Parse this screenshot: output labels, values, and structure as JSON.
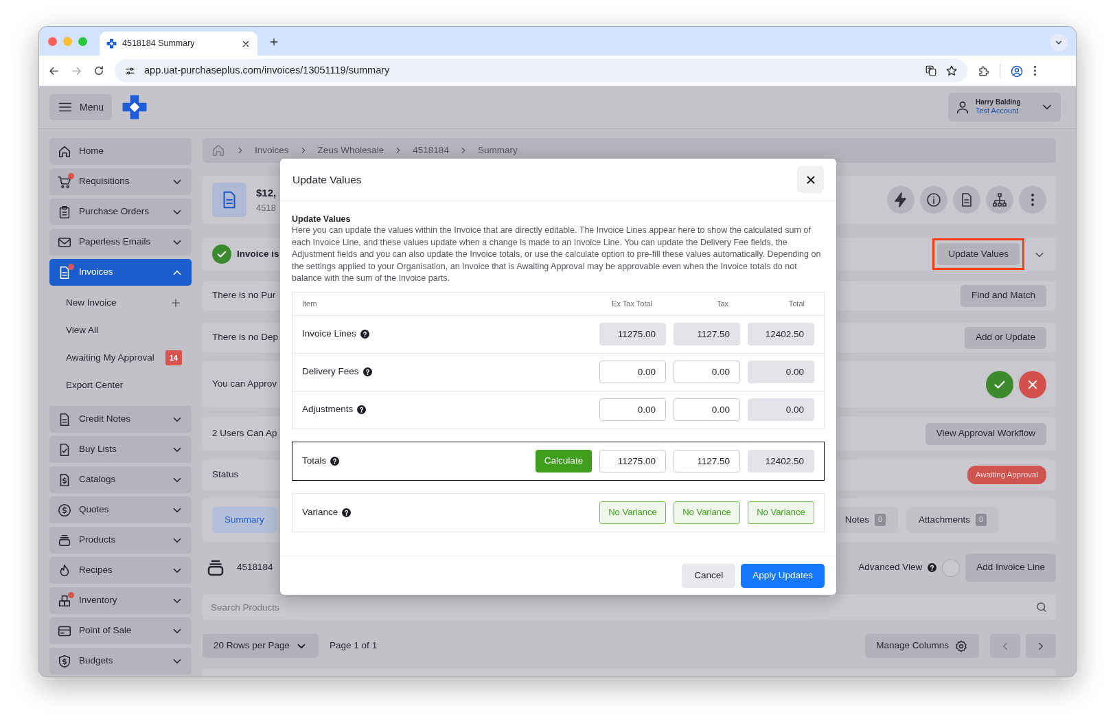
{
  "browser": {
    "tab_title": "4518184 Summary",
    "url": "app.uat-purchaseplus.com/invoices/13051119/summary"
  },
  "header": {
    "menu_label": "Menu",
    "user_name": "Harry Balding",
    "account": "Test Account"
  },
  "sidebar": {
    "items": [
      {
        "label": "Home",
        "kind": "link",
        "selected": false,
        "notification": false
      },
      {
        "label": "Requisitions",
        "kind": "group",
        "expanded": false,
        "selected": false,
        "notification": true
      },
      {
        "label": "Purchase Orders",
        "kind": "group",
        "expanded": false,
        "selected": false,
        "notification": false
      },
      {
        "label": "Paperless Emails",
        "kind": "group",
        "expanded": false,
        "selected": false,
        "notification": false
      },
      {
        "label": "Invoices",
        "kind": "group",
        "expanded": true,
        "selected": true,
        "notification": true,
        "children": [
          {
            "label": "New Invoice",
            "kind": "add"
          },
          {
            "label": "View All",
            "kind": "link"
          },
          {
            "label": "Awaiting My Approval",
            "kind": "link",
            "badge": "14"
          },
          {
            "label": "Export Center",
            "kind": "link"
          }
        ]
      },
      {
        "label": "Credit Notes",
        "kind": "group",
        "expanded": false,
        "selected": false,
        "notification": false
      },
      {
        "label": "Buy Lists",
        "kind": "group",
        "expanded": false,
        "selected": false,
        "notification": false
      },
      {
        "label": "Catalogs",
        "kind": "group",
        "expanded": false,
        "selected": false,
        "notification": false
      },
      {
        "label": "Quotes",
        "kind": "group",
        "expanded": false,
        "selected": false,
        "notification": false
      },
      {
        "label": "Products",
        "kind": "group",
        "expanded": false,
        "selected": false,
        "notification": false
      },
      {
        "label": "Recipes",
        "kind": "group",
        "expanded": false,
        "selected": false,
        "notification": false
      },
      {
        "label": "Inventory",
        "kind": "group",
        "expanded": false,
        "selected": false,
        "notification": true
      },
      {
        "label": "Point of Sale",
        "kind": "group",
        "expanded": false,
        "selected": false,
        "notification": false
      },
      {
        "label": "Budgets",
        "kind": "group",
        "expanded": false,
        "selected": false,
        "notification": false
      }
    ]
  },
  "breadcrumb": [
    "Invoices",
    "Zeus Wholesale",
    "4518184",
    "Summary"
  ],
  "summary": {
    "amount": "$12,",
    "number": "4518"
  },
  "rows": [
    {
      "kind": "status",
      "text": "Invoice is",
      "button": "Update Values",
      "highlighted": true
    },
    {
      "kind": "button",
      "text": "There is no Pur",
      "button": "Find and Match"
    },
    {
      "kind": "button",
      "text": "There is no Dep",
      "button": "Add or Update"
    },
    {
      "kind": "approve",
      "text": "You can Approv"
    },
    {
      "kind": "button",
      "text": "2 Users Can Ap",
      "button": "View Approval Workflow"
    },
    {
      "kind": "badge",
      "text": "Status",
      "badge": "Awaiting Approval"
    }
  ],
  "tabs": [
    {
      "label": "Summary",
      "selected": true
    },
    {
      "label": "Notes",
      "count": "0",
      "selected": false
    },
    {
      "label": "Attachments",
      "count": "0",
      "selected": false
    }
  ],
  "lines_bar": {
    "title": "4518184",
    "advanced_view_label": "Advanced View",
    "advanced_view_on": false,
    "button": "Add Invoice Line"
  },
  "search": {
    "placeholder": "Search Products"
  },
  "pager": {
    "rows_per_page": "20 Rows per Page",
    "page": "Page 1 of 1",
    "manage_columns": "Manage Columns"
  },
  "modal": {
    "title": "Update Values",
    "heading": "Update Values",
    "description": "Here you can update the values within the Invoice that are directly editable. The Invoice Lines appear here to show the calculated sum of each Invoice Line, and these values update when a change is made to an Invoice Line. You can update the Delivery Fee fields, the Adjustment fields and you can also update the Invoice totals, or use the calculate option to pre-fill these values automatically. Depending on the settings applied to your Organisation, an Invoice that is Awaiting Approval may be approvable even when the Invoice totals do not balance with the sum of the Invoice parts.",
    "columns": [
      "Item",
      "Ex Tax Total",
      "Tax",
      "Total"
    ],
    "rows": [
      {
        "label": "Invoice Lines",
        "values": [
          {
            "value": "11275.00",
            "editable": false
          },
          {
            "value": "1127.50",
            "editable": false
          },
          {
            "value": "12402.50",
            "editable": false
          }
        ]
      },
      {
        "label": "Delivery Fees",
        "values": [
          {
            "value": "0.00",
            "editable": true
          },
          {
            "value": "0.00",
            "editable": true
          },
          {
            "value": "0.00",
            "editable": false
          }
        ]
      },
      {
        "label": "Adjustments",
        "values": [
          {
            "value": "0.00",
            "editable": true
          },
          {
            "value": "0.00",
            "editable": true
          },
          {
            "value": "0.00",
            "editable": false
          }
        ]
      }
    ],
    "totals": {
      "label": "Totals",
      "calculate": "Calculate",
      "values": [
        {
          "value": "11275.00",
          "editable": true
        },
        {
          "value": "1127.50",
          "editable": true
        },
        {
          "value": "12402.50",
          "editable": false
        }
      ]
    },
    "variance": {
      "label": "Variance",
      "values": [
        "No Variance",
        "No Variance",
        "No Variance"
      ]
    },
    "cancel": "Cancel",
    "apply": "Apply Updates"
  }
}
